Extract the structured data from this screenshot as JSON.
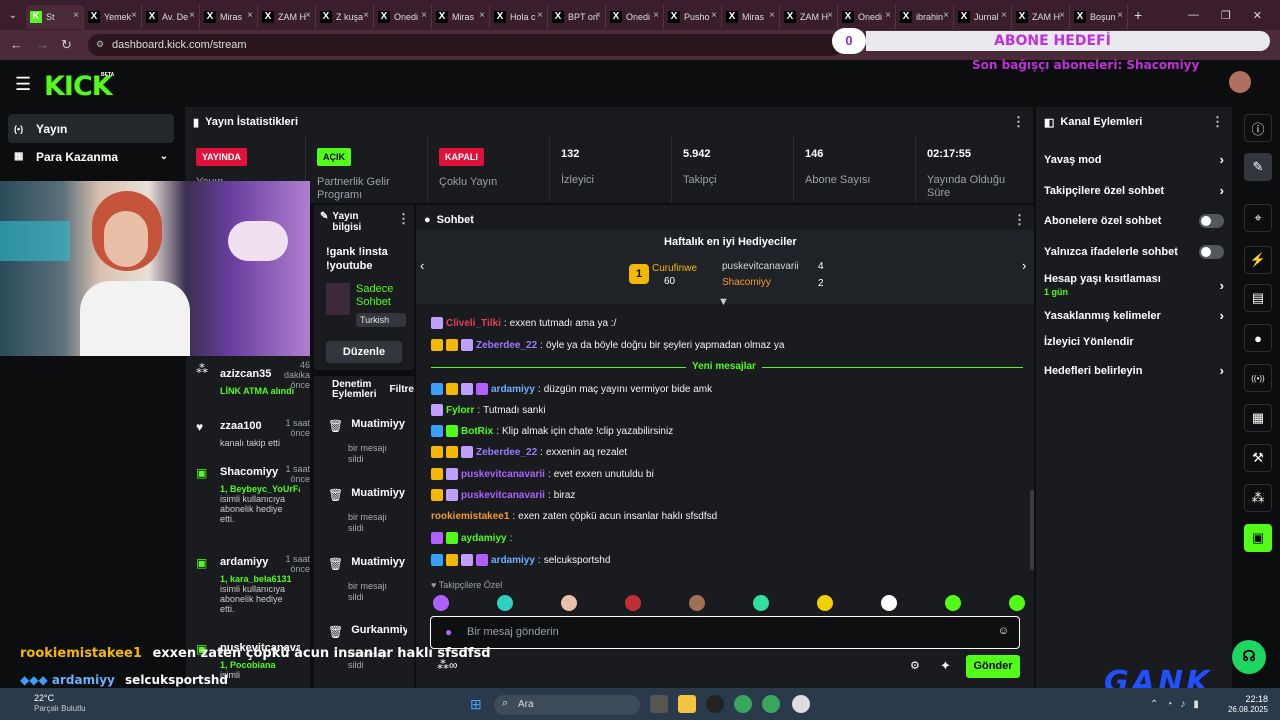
{
  "browser": {
    "tabs": [
      {
        "label": "St",
        "fav": "K",
        "color": "#53fc18",
        "active": true
      },
      {
        "label": "Yemek",
        "fav": "X",
        "color": "#000"
      },
      {
        "label": "Av. De",
        "fav": "X",
        "color": "#000"
      },
      {
        "label": "Miras",
        "fav": "X",
        "color": "#000"
      },
      {
        "label": "ZAM H",
        "fav": "X",
        "color": "#000"
      },
      {
        "label": "Z kuşa",
        "fav": "X",
        "color": "#000"
      },
      {
        "label": "Onedi",
        "fav": "X",
        "color": "#000"
      },
      {
        "label": "Miras",
        "fav": "X",
        "color": "#000"
      },
      {
        "label": "Hola c",
        "fav": "X",
        "color": "#000"
      },
      {
        "label": "BPT on",
        "fav": "X",
        "color": "#000"
      },
      {
        "label": "Onedi",
        "fav": "X",
        "color": "#000"
      },
      {
        "label": "Pusho",
        "fav": "X",
        "color": "#000"
      },
      {
        "label": "Miras",
        "fav": "X",
        "color": "#000"
      },
      {
        "label": "ZAM H",
        "fav": "X",
        "color": "#000"
      },
      {
        "label": "Onedi",
        "fav": "X",
        "color": "#000"
      },
      {
        "label": "ibrahin",
        "fav": "X",
        "color": "#000"
      },
      {
        "label": "Jurnal",
        "fav": "X",
        "color": "#000"
      },
      {
        "label": "ZAM H",
        "fav": "X",
        "color": "#000"
      },
      {
        "label": "Boşun",
        "fav": "X",
        "color": "#000"
      }
    ],
    "url": "dashboard.kick.com/stream"
  },
  "overlay": {
    "goal_count": "0",
    "goal_title": "ABONE HEDEFİ",
    "last_sub": "Son bağışçı aboneleri: Shacomiyy",
    "brand": "GANK"
  },
  "kick": {
    "logo": "KICK",
    "beta": "BETA"
  },
  "sidebar": {
    "items": [
      {
        "label": "Yayın",
        "icon": "(•)"
      },
      {
        "label": "Para Kazanma",
        "icon": "▦"
      }
    ]
  },
  "stats": {
    "title": "Yayın İstatistikleri",
    "cards": [
      {
        "badge": "YAYINDA",
        "badge_color": "#e0123c",
        "label": "Yayın"
      },
      {
        "badge": "AÇIK",
        "badge_color": "#53fc18",
        "label": "Partnerlik Gelir Programı"
      },
      {
        "badge": "KAPALI",
        "badge_color": "#e0123c",
        "label": "Çoklu Yayın"
      },
      {
        "value": "132",
        "label": "İzleyici"
      },
      {
        "value": "5.942",
        "label": "Takipçi"
      },
      {
        "value": "146",
        "label": "Abone Sayısı"
      },
      {
        "value": "02:17:55",
        "label": "Yayında Olduğu Süre"
      }
    ]
  },
  "stream_info": {
    "title": "Yayın bilgisi",
    "text": "!gank !insta !youtube",
    "game": "Sadece Sohbet",
    "lang": "Turkish",
    "edit": "Düzenle"
  },
  "feed": [
    {
      "name": "azizcan35",
      "time": "46 dakika önce",
      "sub": "LİNK ATMA alındı",
      "icon": "gift"
    },
    {
      "name": "zzaa100",
      "time": "1 saat önce",
      "sub": "kanalı takip etti",
      "icon": "heart"
    },
    {
      "name": "Shacomiyy",
      "time": "1 saat önce",
      "sub2": "1, Beybeyc_YoUrFa...",
      "sub": "isimli kullanıcıya abonelik hediye etti.",
      "icon": "giftbox"
    },
    {
      "name": "ardamiyy",
      "time": "1 saat önce",
      "sub2": "1, kara_bela6131",
      "sub": "isimli kullanıcıya abonelik hediye etti.",
      "icon": "giftbox"
    },
    {
      "name": "puskevitcanavar",
      "time": "",
      "sub2": "1, Pocobiana",
      "sub": "isimli",
      "icon": "giftbox"
    }
  ],
  "mod": {
    "title": "Denetim Eylemleri",
    "filter": "Filtre",
    "items": [
      {
        "name": "Muatimiyy",
        "sub": "bir mesajı sildi"
      },
      {
        "name": "Muatimiyy",
        "sub": "bir mesajı sildi"
      },
      {
        "name": "Muatimiyy",
        "sub": "bir mesajı sildi"
      },
      {
        "name": "Gurkanmiy",
        "sub": "bir mesajı sildi"
      }
    ]
  },
  "chat": {
    "title": "Sohbet",
    "top_gifters_title": "Haftalık en iyi Hediyeciler",
    "gifters": {
      "first": {
        "name": "Curufinwe",
        "count": "60"
      },
      "second": {
        "name": "puskevitcanavarii",
        "count": "4"
      },
      "third": {
        "name": "Shacomiyy",
        "count": "2"
      }
    },
    "new_messages": "Yeni mesajlar",
    "messages": [
      {
        "user": "Cliveli_Tilki",
        "color": "#e0405a",
        "text": "exxen tutmadı ama ya :/",
        "icons": [
          "#c0a0ff"
        ]
      },
      {
        "user": "Zeberdee_22",
        "color": "#9b7bff",
        "text": "öyle ya da böyle doğru bir şeyleri yapmadan olmaz ya",
        "icons": [
          "#f5b800",
          "#f5b800",
          "#c0a0ff"
        ]
      },
      {
        "user": "ardamiyy",
        "color": "#6ab0ff",
        "text": "düzgün maç yayını vermiyor bide amk",
        "icons": [
          "#3aa0ff",
          "#f5b800",
          "#c0a0ff",
          "#b060ff"
        ]
      },
      {
        "user": "Fylorr",
        "color": "#53fc18",
        "text": "Tutmadı sanki",
        "icons": [
          "#c0a0ff"
        ]
      },
      {
        "user": "BotRix",
        "color": "#53fc18",
        "text": "Klip almak için chate !clip yazabilirsiniz",
        "icons": [
          "#3aa0ff",
          "#53fc18"
        ]
      },
      {
        "user": "Zeberdee_22",
        "color": "#9b7bff",
        "text": "exxenin aq rezalet",
        "icons": [
          "#f5b800",
          "#f5b800",
          "#c0a0ff"
        ]
      },
      {
        "user": "puskevitcanavarii",
        "color": "#b060ff",
        "text": "evet exxen unutuldu bi",
        "icons": [
          "#f5b800",
          "#c0a0ff"
        ]
      },
      {
        "user": "puskevitcanavarii",
        "color": "#b060ff",
        "text": "biraz",
        "icons": [
          "#f5b800",
          "#c0a0ff"
        ]
      },
      {
        "user": "rookiemistakee1",
        "color": "#f59a2e",
        "text": "exen zaten çöpkü acun insanlar haklı sfsdfsd",
        "icons": []
      },
      {
        "user": "aydamiyy",
        "color": "#53fc18",
        "text": "",
        "icons": [
          "#b060ff",
          "#53fc18"
        ]
      },
      {
        "user": "ardamiyy",
        "color": "#6ab0ff",
        "text": "selcuksportshd",
        "icons": [
          "#3aa0ff",
          "#f5b800",
          "#c0a0ff",
          "#b060ff"
        ]
      }
    ],
    "followers_only": "Takipçilere Özel",
    "placeholder": "Bir mesaj gönderin",
    "send": "Gönder"
  },
  "actions": {
    "title": "Kanal Eylemleri",
    "items": [
      {
        "label": "Yavaş mod",
        "type": "chev"
      },
      {
        "label": "Takipçilere özel sohbet",
        "type": "chev"
      },
      {
        "label": "Abonelere özel sohbet",
        "type": "toggle"
      },
      {
        "label": "Yalnızca ifadelerle sohbet",
        "type": "toggle"
      },
      {
        "label": "Hesap yaşı kısıtlaması",
        "sub": "1 gün",
        "type": "chev"
      },
      {
        "label": "Yasaklanmış kelimeler",
        "type": "chev"
      },
      {
        "label": "İzleyici Yönlendir",
        "type": "none"
      },
      {
        "label": "Hedefleri belirleyin",
        "type": "chev"
      }
    ]
  },
  "stream_overlay": {
    "l1_user": "rookiemistakee1",
    "l1_text": "exxen zaten çöpkü acun insanlar haklı sfsdfsd",
    "l2_user": "ardamiyy",
    "l2_text": "selcuksportshd",
    "l3_user": "aydamiyy"
  },
  "taskbar": {
    "weather": "22°C",
    "weather_sub": "Parçalı Bulutlu",
    "search": "Ara",
    "time": "22:18",
    "date": "26.08.2025"
  }
}
